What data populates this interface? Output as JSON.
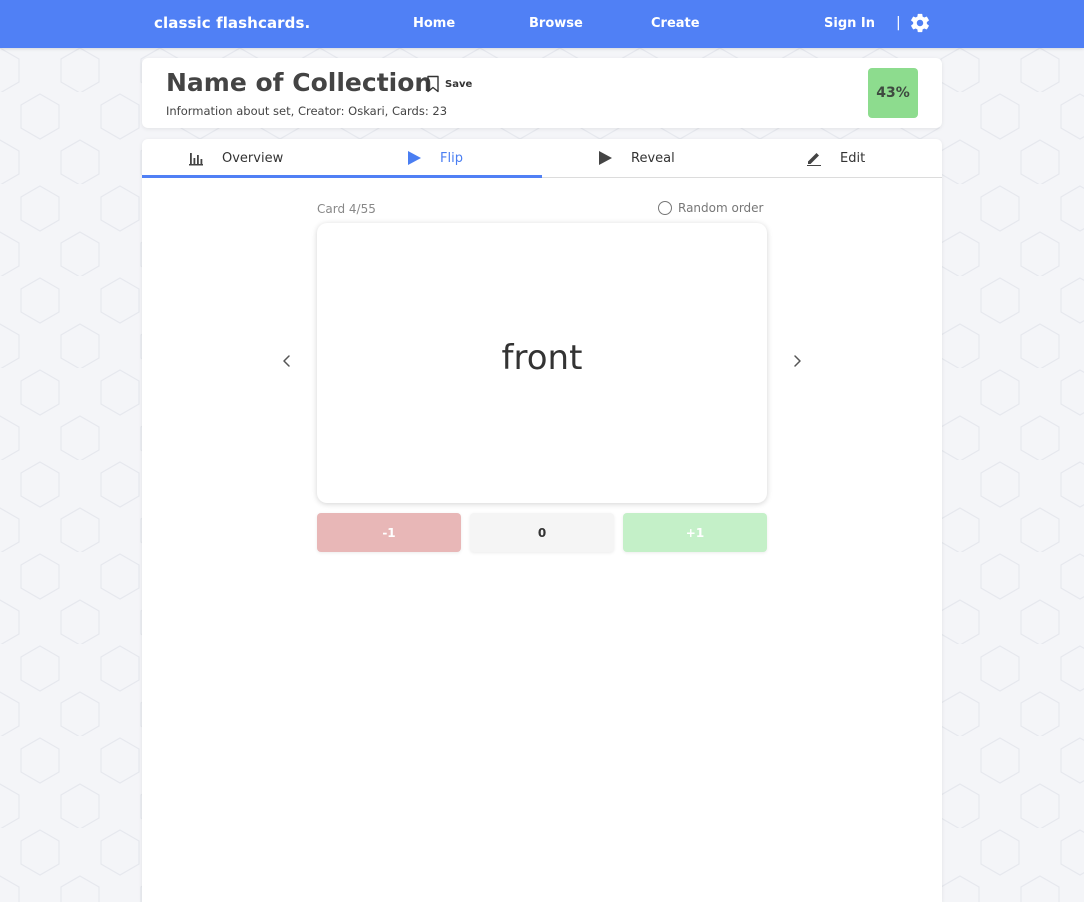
{
  "navbar": {
    "brand": "classic flashcards.",
    "links": [
      "Home",
      "Browse",
      "Create"
    ],
    "sign_in": "Sign In",
    "separator": "|",
    "settings_icon": "gear-icon",
    "color": "#5080f5"
  },
  "collection": {
    "title": "Name of Collection",
    "save_label": "Save",
    "info": "Information about set, Creator: Oskari, Cards: 23",
    "progress": "43%",
    "progress_color": "#8ddc8e"
  },
  "tabs": [
    {
      "label": "Overview",
      "icon": "bar-chart-icon",
      "active": false
    },
    {
      "label": "Flip",
      "icon": "play-icon",
      "active": true
    },
    {
      "label": "Reveal",
      "icon": "play-icon",
      "active": false
    },
    {
      "label": "Edit",
      "icon": "pencil-icon",
      "active": false
    }
  ],
  "study": {
    "card_counter": "Card 4/55",
    "random_order_label": "Random order",
    "random_order_checked": false,
    "card_text": "front",
    "prev_icon": "chevron-left-icon",
    "next_icon": "chevron-right-icon",
    "buttons": {
      "minus": "-1",
      "zero": "0",
      "plus": "+1"
    },
    "colors": {
      "minus": "#e8b7b7",
      "zero": "#f5f5f5",
      "plus": "#c4f0c8"
    }
  }
}
